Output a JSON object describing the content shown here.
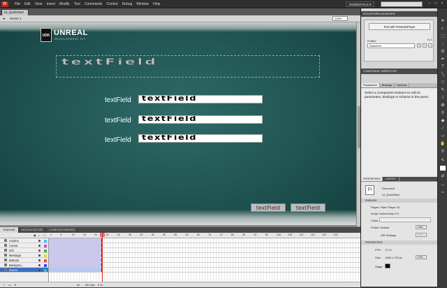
{
  "menubar": {
    "app_logo": "Fl",
    "items": [
      "File",
      "Edit",
      "View",
      "Insert",
      "Modify",
      "Text",
      "Commands",
      "Control",
      "Debug",
      "Window",
      "Help"
    ],
    "workspace": "ESSENTIALS ▾",
    "window_controls": [
      "–",
      "□",
      "×"
    ]
  },
  "document": {
    "tab": "UI_QuickStart",
    "scene": "Scene 1",
    "zoom": "100%"
  },
  "stage": {
    "logo_badge": "UDK",
    "logo_title": "UNREAL",
    "logo_subtitle": "DEVELOPMENT KIT",
    "big_textfield": "textField",
    "rows": [
      {
        "label": "textField",
        "value": "textField"
      },
      {
        "label": "textField",
        "value": "textField"
      },
      {
        "label": "textField",
        "value": "textField"
      }
    ],
    "buttons": [
      "textField",
      "textField"
    ]
  },
  "timeline": {
    "tabs": [
      "TIMELINE",
      "MOTION EDITOR",
      "COMPILER ERRORS"
    ],
    "frame_numbers": [
      "1",
      "5",
      "10",
      "15",
      "20",
      "25",
      "30",
      "35",
      "40",
      "45",
      "50",
      "55",
      "60",
      "65",
      "70",
      "75",
      "80",
      "85",
      "90",
      "95",
      "100",
      "105",
      "110",
      "115",
      "120",
      "125"
    ],
    "layers": [
      {
        "name": "Actions",
        "color": "#44c0ff"
      },
      {
        "name": "Cursor",
        "color": "#e040e0"
      },
      {
        "name": "Info",
        "color": "#30c030"
      },
      {
        "name": "Message",
        "color": "#e0e030"
      },
      {
        "name": "Buttons",
        "color": "#ff4040"
      },
      {
        "name": "Backgrou...",
        "color": "#4040ff"
      },
      {
        "name": "Scene",
        "color": "#30c0c0"
      }
    ],
    "footer": {
      "fps": "30.0 fps",
      "time": "0.7s",
      "frame": "22"
    }
  },
  "scaleform": {
    "title": "SCALEFORM LAUNCHER",
    "button": "Test with FxMediaPlayer",
    "version": "v1.0",
    "profiles_label": "Profiles:",
    "profile_value": "Scaleform"
  },
  "inspector": {
    "title": "COMPONENT INSPECTOR",
    "tabs": [
      "Parameters",
      "Bindings",
      "Schema"
    ],
    "message": "Select a Component instance to edit its parameters, bindings or schema in the panel."
  },
  "properties": {
    "tabs": [
      "PROPERTIES",
      "LIBRARY"
    ],
    "doc_icon": "Fl",
    "doc_type": "Document",
    "doc_name": "UI_QuickStart",
    "publish_header": "PUBLISH",
    "player": "Player: Flash Player 10",
    "script": "Script: ActionScript 2.0",
    "class_label": "Class:",
    "profile": "Profile: Default",
    "edit_label": "Edit...",
    "air": "AIR  Settings",
    "props_header": "PROPERTIES",
    "fps_label": "FPS:",
    "fps_value": "25.00",
    "size_label": "Size:",
    "size_value": "1280 x 720 px",
    "stage_label": "Stage:"
  },
  "colors": {
    "stage_teal": "#1f5452",
    "playhead": "#e0261d",
    "layer_selected": "#3b6fc4"
  }
}
